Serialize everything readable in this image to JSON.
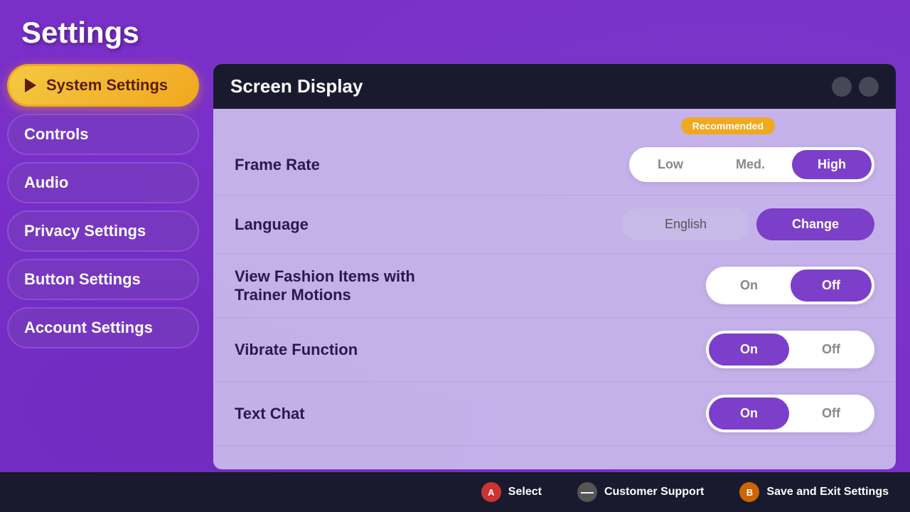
{
  "page": {
    "title": "Settings"
  },
  "sidebar": {
    "items": [
      {
        "id": "system-settings",
        "label": "System Settings",
        "active": true
      },
      {
        "id": "controls",
        "label": "Controls",
        "active": false
      },
      {
        "id": "audio",
        "label": "Audio",
        "active": false
      },
      {
        "id": "privacy-settings",
        "label": "Privacy Settings",
        "active": false
      },
      {
        "id": "button-settings",
        "label": "Button Settings",
        "active": false
      },
      {
        "id": "account-settings",
        "label": "Account Settings",
        "active": false
      }
    ]
  },
  "panel": {
    "title": "Screen Display",
    "recommended_label": "Recommended",
    "settings": [
      {
        "id": "frame-rate",
        "label": "Frame Rate",
        "type": "three-toggle",
        "options": [
          "Low",
          "Med.",
          "High"
        ],
        "selected": "High"
      },
      {
        "id": "language",
        "label": "Language",
        "type": "language",
        "current_value": "English",
        "change_label": "Change"
      },
      {
        "id": "fashion-items",
        "label": "View Fashion Items with\nTrainer Motions",
        "label_line1": "View Fashion Items with",
        "label_line2": "Trainer Motions",
        "type": "on-off",
        "selected": "Off"
      },
      {
        "id": "vibrate-function",
        "label": "Vibrate Function",
        "type": "on-off",
        "selected": "On"
      },
      {
        "id": "text-chat",
        "label": "Text Chat",
        "type": "on-off",
        "selected": "On"
      }
    ]
  },
  "bottom_bar": {
    "actions": [
      {
        "id": "select",
        "button": "A",
        "label": "Select",
        "color": "#cc3333"
      },
      {
        "id": "customer-support",
        "button": "—",
        "label": "Customer Support",
        "color": "#555"
      },
      {
        "id": "save-exit",
        "button": "B",
        "label": "Save and Exit Settings",
        "color": "#cc6600"
      }
    ]
  }
}
